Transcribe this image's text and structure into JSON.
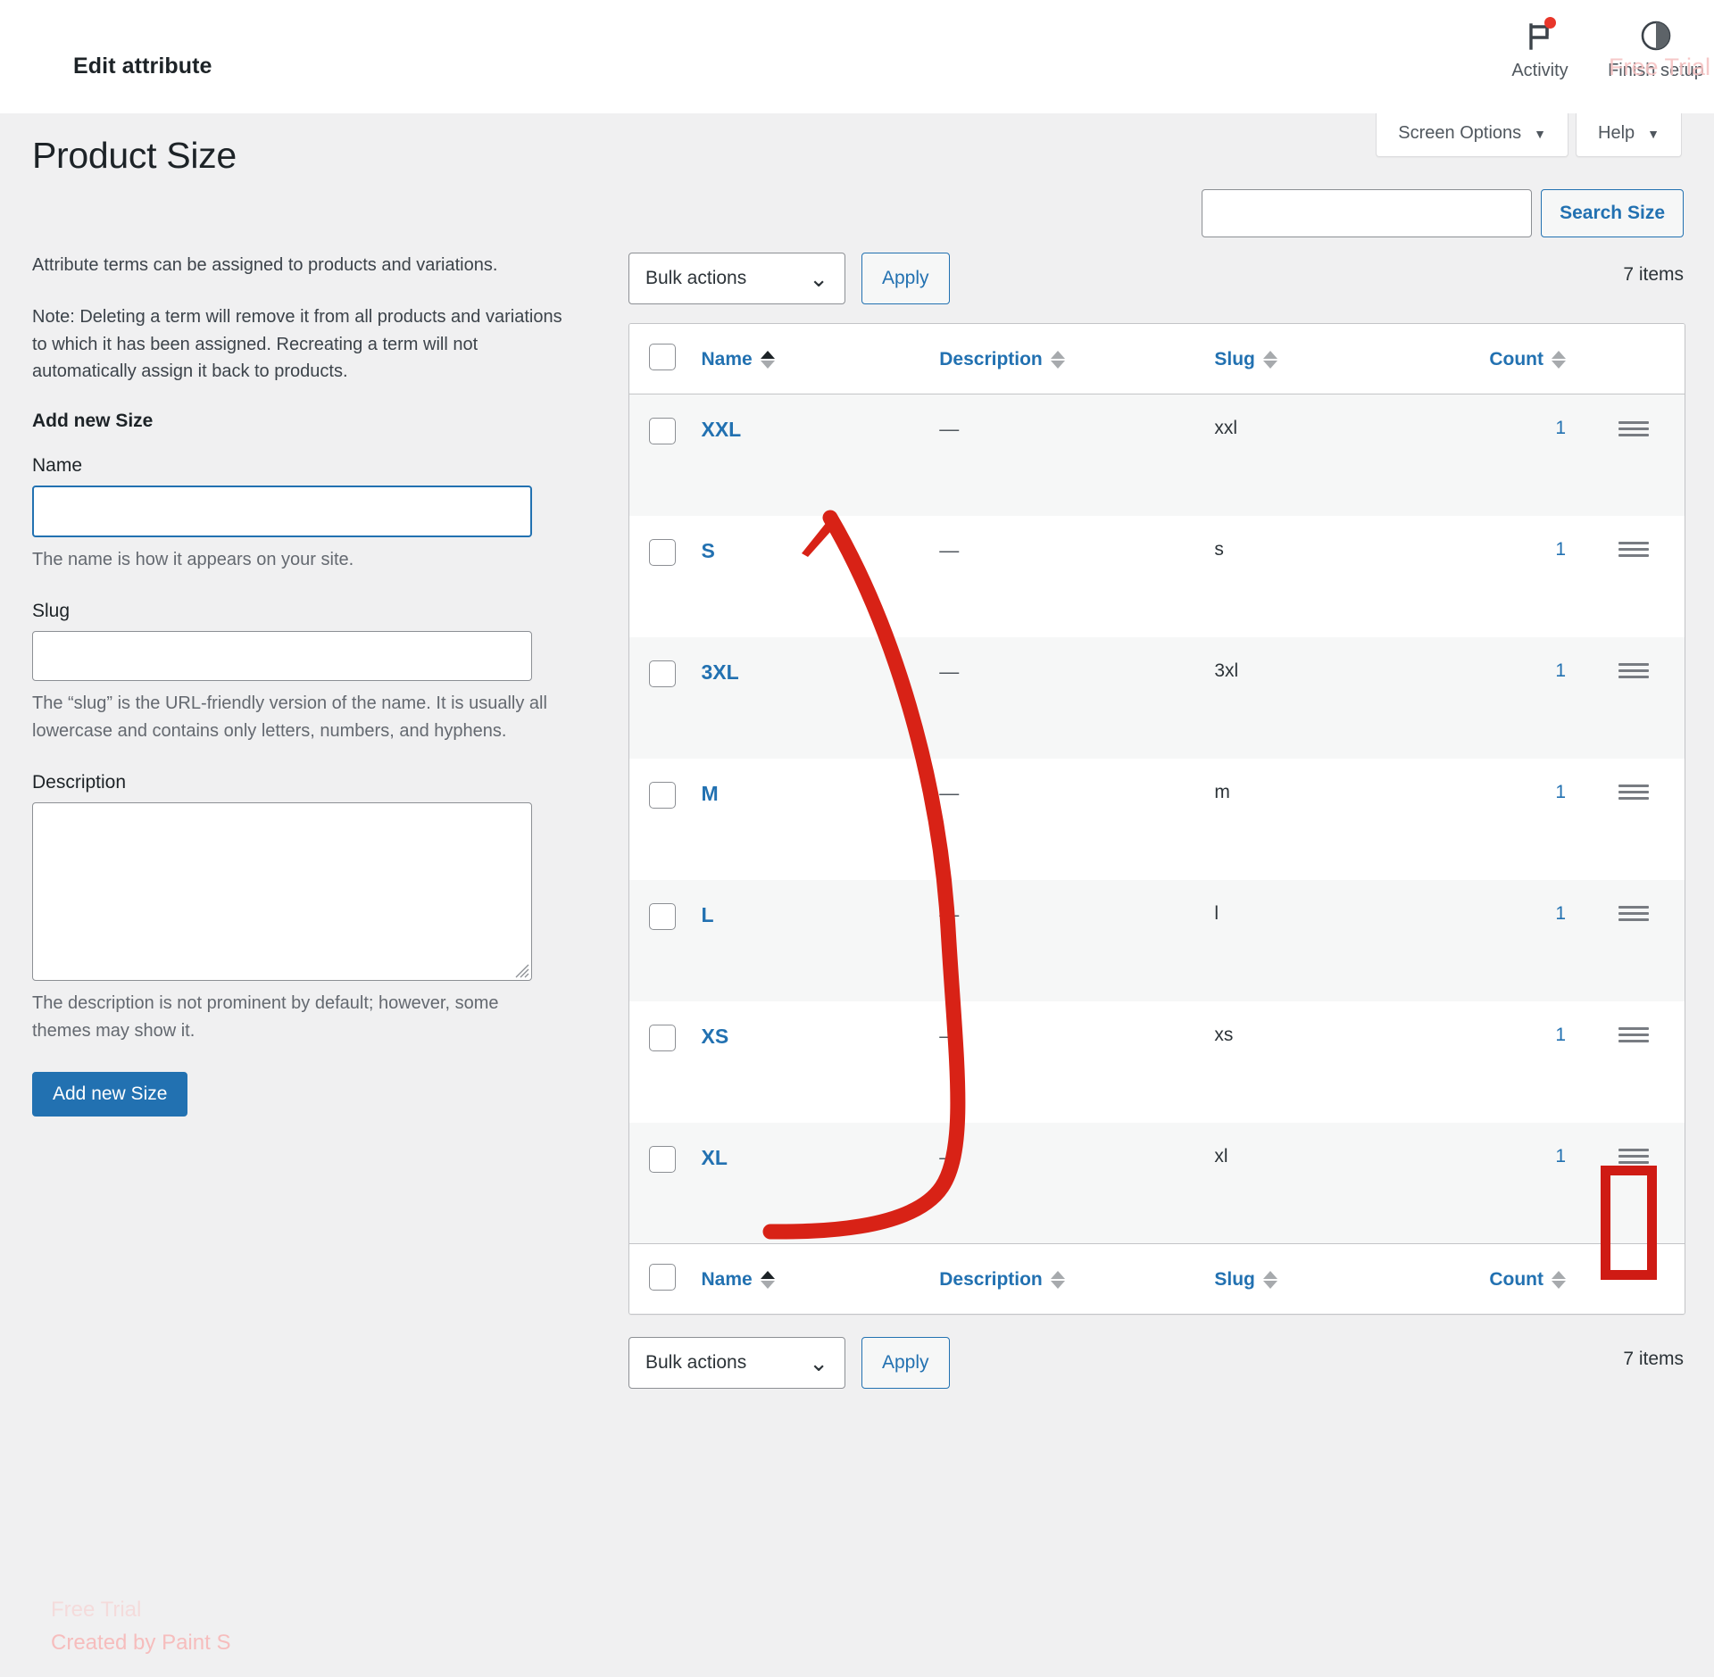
{
  "topbar": {
    "title": "Edit attribute",
    "actions": [
      {
        "label": "Activity",
        "icon": "flag-icon",
        "has_badge": true
      },
      {
        "label": "Finish setup",
        "icon": "half-circle-progress-icon",
        "has_badge": false
      }
    ]
  },
  "screen_options": {
    "screen_options_label": "Screen Options",
    "help_label": "Help",
    "caret": "▼"
  },
  "page": {
    "title": "Product Size"
  },
  "search": {
    "value": "",
    "placeholder": "",
    "button_label": "Search Size"
  },
  "left": {
    "intro_paragraph": "Attribute terms can be assigned to products and variations.",
    "note_paragraph": "Note: Deleting a term will remove it from all products and variations to which it has been assigned. Recreating a term will not automatically assign it back to products.",
    "section_heading": "Add new Size",
    "name_label": "Name",
    "name_value": "",
    "name_help": "The name is how it appears on your site.",
    "slug_label": "Slug",
    "slug_value": "",
    "slug_help": "The “slug” is the URL-friendly version of the name. It is usually all lowercase and contains only letters, numbers, and hyphens.",
    "description_label": "Description",
    "description_value": "",
    "description_help": "The description is not prominent by default; however, some themes may show it.",
    "submit_label": "Add new Size"
  },
  "tablenav_top": {
    "bulk_actions_label": "Bulk actions",
    "bulk_caret": "⌄",
    "apply_label": "Apply",
    "items_count": "7 items"
  },
  "tablenav_bottom": {
    "bulk_actions_label": "Bulk actions",
    "bulk_caret": "⌄",
    "apply_label": "Apply",
    "items_count": "7 items"
  },
  "table": {
    "columns": {
      "name": "Name",
      "description": "Description",
      "slug": "Slug",
      "count": "Count"
    },
    "sorted_by": "name",
    "sort_direction": "asc",
    "rows": [
      {
        "name": "XXL",
        "description": "—",
        "slug": "xxl",
        "count": "1",
        "handle": "drag-handle-icon"
      },
      {
        "name": "S",
        "description": "—",
        "slug": "s",
        "count": "1",
        "handle": "drag-handle-icon"
      },
      {
        "name": "3XL",
        "description": "—",
        "slug": "3xl",
        "count": "1",
        "handle": "drag-handle-icon"
      },
      {
        "name": "M",
        "description": "—",
        "slug": "m",
        "count": "1",
        "handle": "drag-handle-icon"
      },
      {
        "name": "L",
        "description": "—",
        "slug": "l",
        "count": "1",
        "handle": "drag-handle-icon"
      },
      {
        "name": "XS",
        "description": "—",
        "slug": "xs",
        "count": "1",
        "handle": "drag-handle-icon"
      },
      {
        "name": "XL",
        "description": "—",
        "slug": "xl",
        "count": "1",
        "handle": "drag-handle-icon"
      }
    ]
  },
  "annotation": {
    "highlight_target": "XS row drag handle",
    "highlight_color": "#cf1b14",
    "arrow_color": "#d82216",
    "arrow_from": "XS row name cell",
    "arrow_to": "XXL row name cell"
  },
  "watermarks": {
    "free_trial": "Free Trial",
    "created_by": "Created by Paint S",
    "table_created_by": "Created by Paint S"
  }
}
